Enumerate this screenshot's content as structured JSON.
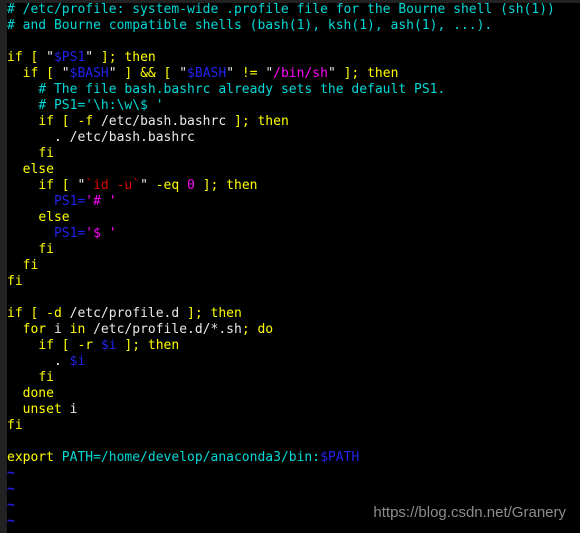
{
  "terminal": {
    "background_color": "#000000",
    "gutter_color": "#222222",
    "colors": {
      "comment": "#00d8d8",
      "keyword": "#ffff00",
      "variable": "#2222ee",
      "string": "#ff00ff",
      "command_substitution": "#dd0000",
      "number": "#ff00ff",
      "plain": "#e8e8e8",
      "tilde": "#2222dd",
      "watermark": "#8c8c8c"
    },
    "file_opened": "/etc/profile",
    "empty_line_marker": "~",
    "empty_line_count": 4
  },
  "watermark": {
    "text": "https://blog.csdn.net/Granery"
  },
  "lines": [
    {
      "id": 1,
      "indent": 0,
      "tokens": [
        {
          "t": "# /etc/profile: system-wide .profile file for the Bourne shell (sh(1))",
          "c": "comment"
        }
      ]
    },
    {
      "id": 2,
      "indent": 0,
      "tokens": [
        {
          "t": "# and Bourne compatible shells (bash(1), ksh(1), ash(1), ...).",
          "c": "comment"
        }
      ]
    },
    {
      "id": 3,
      "indent": 0,
      "tokens": []
    },
    {
      "id": 4,
      "indent": 0,
      "tokens": [
        {
          "t": "if [ ",
          "c": "keyword"
        },
        {
          "t": "\"",
          "c": "quote"
        },
        {
          "t": "$PS1",
          "c": "variable"
        },
        {
          "t": "\"",
          "c": "quote"
        },
        {
          "t": " ]; then",
          "c": "keyword"
        }
      ]
    },
    {
      "id": 5,
      "indent": 1,
      "tokens": [
        {
          "t": "if [ ",
          "c": "keyword"
        },
        {
          "t": "\"",
          "c": "quote"
        },
        {
          "t": "$BASH",
          "c": "variable"
        },
        {
          "t": "\"",
          "c": "quote"
        },
        {
          "t": " ] && [ ",
          "c": "keyword"
        },
        {
          "t": "\"",
          "c": "quote"
        },
        {
          "t": "$BASH",
          "c": "variable"
        },
        {
          "t": "\"",
          "c": "quote"
        },
        {
          "t": " != ",
          "c": "keyword"
        },
        {
          "t": "\"",
          "c": "quote"
        },
        {
          "t": "/bin/sh",
          "c": "string"
        },
        {
          "t": "\"",
          "c": "quote"
        },
        {
          "t": " ]; then",
          "c": "keyword"
        }
      ]
    },
    {
      "id": 6,
      "indent": 2,
      "tokens": [
        {
          "t": "# The file bash.bashrc already sets the default PS1.",
          "c": "comment"
        }
      ]
    },
    {
      "id": 7,
      "indent": 2,
      "tokens": [
        {
          "t": "# PS1='\\h:\\w\\$ '",
          "c": "comment"
        }
      ]
    },
    {
      "id": 8,
      "indent": 2,
      "tokens": [
        {
          "t": "if [ -f ",
          "c": "keyword"
        },
        {
          "t": "/etc/bash.bashrc",
          "c": "plain"
        },
        {
          "t": " ]; then",
          "c": "keyword"
        }
      ]
    },
    {
      "id": 9,
      "indent": 3,
      "tokens": [
        {
          "t": ". /etc/bash.bashrc",
          "c": "plain"
        }
      ]
    },
    {
      "id": 10,
      "indent": 2,
      "tokens": [
        {
          "t": "fi",
          "c": "keyword"
        }
      ]
    },
    {
      "id": 11,
      "indent": 1,
      "tokens": [
        {
          "t": "else",
          "c": "keyword"
        }
      ]
    },
    {
      "id": 12,
      "indent": 2,
      "tokens": [
        {
          "t": "if [ ",
          "c": "keyword"
        },
        {
          "t": "\"",
          "c": "quote"
        },
        {
          "t": "`id -u`",
          "c": "command_substitution"
        },
        {
          "t": "\"",
          "c": "quote"
        },
        {
          "t": " -eq ",
          "c": "keyword"
        },
        {
          "t": "0",
          "c": "number"
        },
        {
          "t": " ]; then",
          "c": "keyword"
        }
      ]
    },
    {
      "id": 13,
      "indent": 3,
      "tokens": [
        {
          "t": "PS1=",
          "c": "variable"
        },
        {
          "t": "'# '",
          "c": "string"
        }
      ]
    },
    {
      "id": 14,
      "indent": 2,
      "tokens": [
        {
          "t": "else",
          "c": "keyword"
        }
      ]
    },
    {
      "id": 15,
      "indent": 3,
      "tokens": [
        {
          "t": "PS1=",
          "c": "variable"
        },
        {
          "t": "'$ '",
          "c": "string"
        }
      ]
    },
    {
      "id": 16,
      "indent": 2,
      "tokens": [
        {
          "t": "fi",
          "c": "keyword"
        }
      ]
    },
    {
      "id": 17,
      "indent": 1,
      "tokens": [
        {
          "t": "fi",
          "c": "keyword"
        }
      ]
    },
    {
      "id": 18,
      "indent": 0,
      "tokens": [
        {
          "t": "fi",
          "c": "keyword"
        }
      ]
    },
    {
      "id": 19,
      "indent": 0,
      "tokens": []
    },
    {
      "id": 20,
      "indent": 0,
      "tokens": [
        {
          "t": "if [ -d ",
          "c": "keyword"
        },
        {
          "t": "/etc/profile.d",
          "c": "plain"
        },
        {
          "t": " ]; then",
          "c": "keyword"
        }
      ]
    },
    {
      "id": 21,
      "indent": 1,
      "tokens": [
        {
          "t": "for",
          "c": "keyword"
        },
        {
          "t": " i ",
          "c": "plain"
        },
        {
          "t": "in",
          "c": "keyword"
        },
        {
          "t": " /etc/profile.d/*.sh",
          "c": "plain"
        },
        {
          "t": "; do",
          "c": "keyword"
        }
      ]
    },
    {
      "id": 22,
      "indent": 2,
      "tokens": [
        {
          "t": "if [ -r ",
          "c": "keyword"
        },
        {
          "t": "$i",
          "c": "variable"
        },
        {
          "t": " ]; then",
          "c": "keyword"
        }
      ]
    },
    {
      "id": 23,
      "indent": 3,
      "tokens": [
        {
          "t": ". ",
          "c": "plain"
        },
        {
          "t": "$i",
          "c": "variable"
        }
      ]
    },
    {
      "id": 24,
      "indent": 2,
      "tokens": [
        {
          "t": "fi",
          "c": "keyword"
        }
      ]
    },
    {
      "id": 25,
      "indent": 1,
      "tokens": [
        {
          "t": "done",
          "c": "keyword"
        }
      ]
    },
    {
      "id": 26,
      "indent": 1,
      "tokens": [
        {
          "t": "unset",
          "c": "keyword"
        },
        {
          "t": " i",
          "c": "plain"
        }
      ]
    },
    {
      "id": 27,
      "indent": 0,
      "tokens": [
        {
          "t": "fi",
          "c": "keyword"
        }
      ]
    },
    {
      "id": 28,
      "indent": 0,
      "tokens": []
    },
    {
      "id": 29,
      "indent": 0,
      "tokens": [
        {
          "t": "export",
          "c": "keyword"
        },
        {
          "t": " PATH=/home/develop/anaconda3/bin:",
          "c": "cyan"
        },
        {
          "t": "$PATH",
          "c": "variable"
        }
      ]
    }
  ]
}
